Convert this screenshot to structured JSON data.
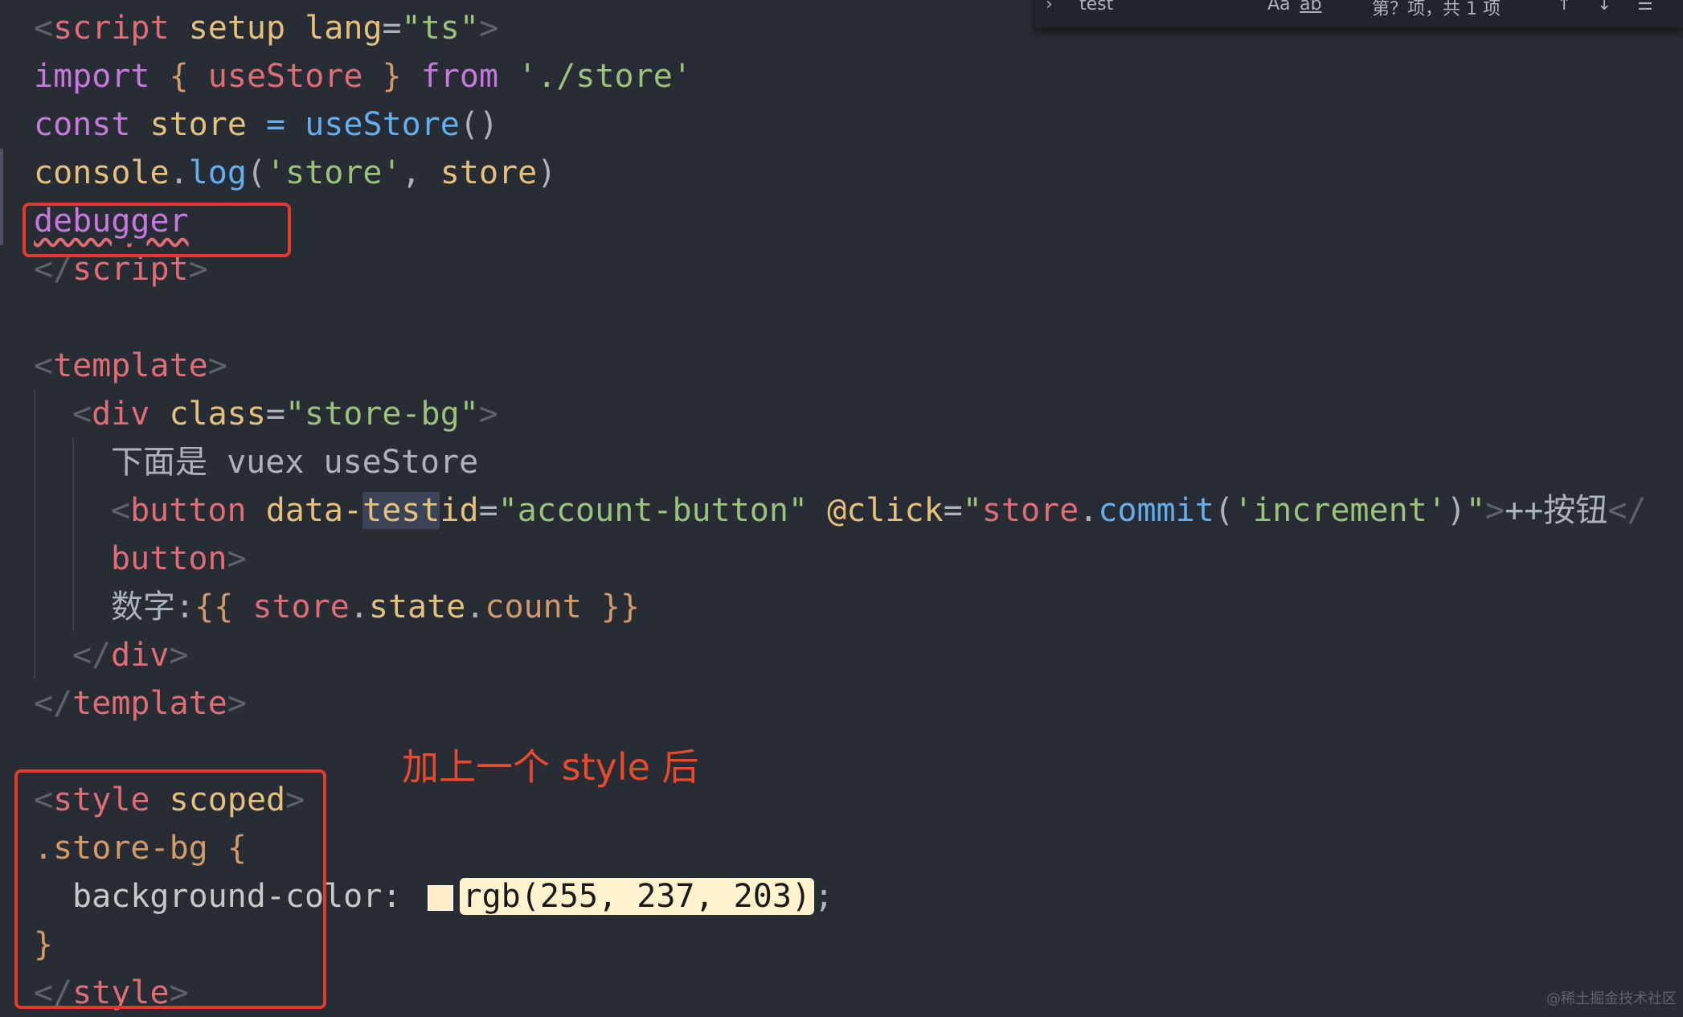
{
  "find_bar": {
    "query": "test",
    "case_label": "Aa",
    "word_label": "ab",
    "result_text": "第？项，共 1 项"
  },
  "code": {
    "l1": {
      "open": "<",
      "tag": "script",
      "a1": "setup",
      "a2": "lang",
      "eq": "=",
      "val": "\"ts\"",
      "close": ">"
    },
    "l2": {
      "kw": "import",
      "brace_open": "{",
      "name": "useStore",
      "brace_close": "}",
      "from": "from",
      "path": "'./store'"
    },
    "l3": {
      "kw": "const",
      "name": "store",
      "eq": "=",
      "fn": "useStore",
      "parens": "()"
    },
    "l4": {
      "obj": "console",
      "dot": ".",
      "fn": "log",
      "p1": "(",
      "s": "'store'",
      "comma": ",",
      "arg": "store",
      "p2": ")"
    },
    "l5": {
      "kw": "debugger"
    },
    "l6": {
      "open": "</",
      "tag": "script",
      "close": ">"
    },
    "l8": {
      "open": "<",
      "tag": "template",
      "close": ">"
    },
    "l9": {
      "open": "<",
      "tag": "div",
      "attr": "class",
      "eq": "=",
      "val": "\"store-bg\"",
      "close": ">"
    },
    "l10": {
      "text": "下面是 vuex useStore"
    },
    "l11": {
      "open": "<",
      "tag": "button",
      "a1a": "data-",
      "a1b": "test",
      "a1c": "id",
      "eq": "=",
      "v1": "\"account-button\"",
      "a2": "@click",
      "eq2": "=",
      "q": "\"",
      "obj": "store",
      "dot": ".",
      "fn": "commit",
      "p1": "(",
      "s": "'increment'",
      "p2": ")",
      "q2": "\"",
      "close": ">",
      "text": "++按钮",
      "end": "</"
    },
    "l12": {
      "tag": "button",
      "close": ">"
    },
    "l13": {
      "text": "数字:",
      "b1": "{{",
      "obj": "store",
      "d1": ".",
      "mid": "state",
      "d2": ".",
      "prop": "count",
      "b2": "}}"
    },
    "l14": {
      "open": "</",
      "tag": "div",
      "close": ">"
    },
    "l15": {
      "open": "</",
      "tag": "template",
      "close": ">"
    },
    "l17": {
      "open": "<",
      "tag": "style",
      "attr": "scoped",
      "close": ">"
    },
    "l18": {
      "sel": ".store-bg",
      "brace": "{"
    },
    "l19": {
      "prop": "background-color:",
      "value": "rgb(255, 237, 203)",
      "semi": ";"
    },
    "l20": {
      "brace": "}"
    },
    "l21": {
      "open": "</",
      "tag": "style",
      "close": ">"
    }
  },
  "annotation": {
    "note": "加上一个 style 后"
  },
  "colors": {
    "swatch": "#ffedcb",
    "highlight_box": "#e03c2c"
  },
  "watermark": "@稀土掘金技术社区"
}
